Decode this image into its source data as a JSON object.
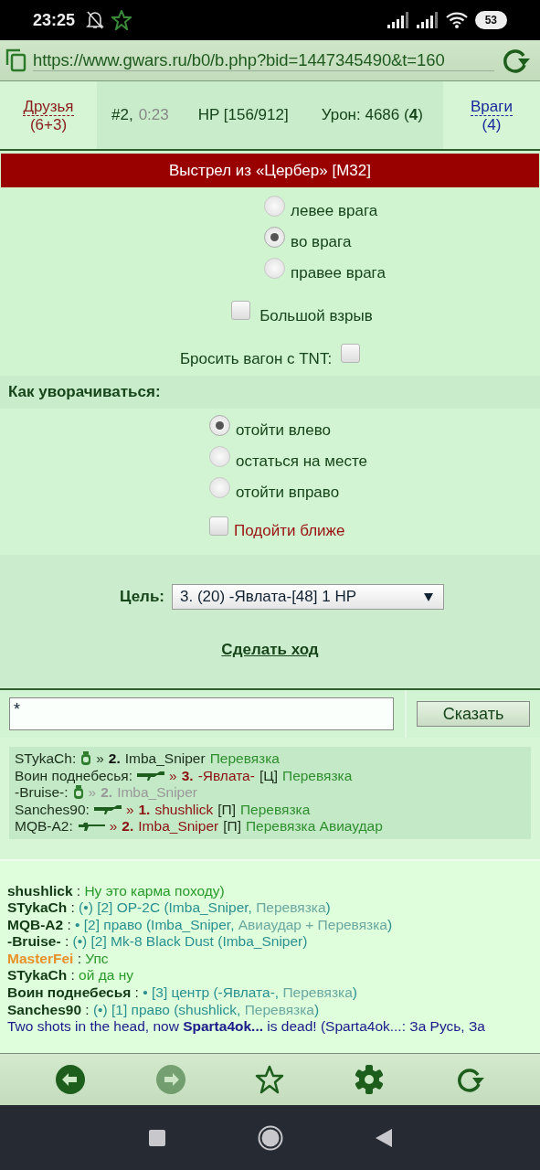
{
  "status_bar": {
    "time": "23:25",
    "battery": "53"
  },
  "address_bar": {
    "url": "https://www.gwars.ru/b0/b.php?bid=1447345490&t=160"
  },
  "header": {
    "friends": {
      "label": "Друзья",
      "count": "(6+3)"
    },
    "turn": "#2,",
    "timer": "0:23",
    "hp": "HP [156/912]",
    "damage": "Урон: 4686 (**4**)",
    "enemies": {
      "label": "Враги",
      "count": "(4)"
    }
  },
  "shot": {
    "title": "Выстрел из «Цербер» [M32]",
    "aim": [
      {
        "label": "левее врага",
        "selected": false
      },
      {
        "label": "во врага",
        "selected": true
      },
      {
        "label": "правее врага",
        "selected": false
      }
    ],
    "big_blast": {
      "label": "Большой взрыв",
      "checked": false
    },
    "tnt": {
      "label": "Бросить вагон с TNT:",
      "checked": false
    }
  },
  "dodge": {
    "title": "Как уворачиваться:",
    "options": [
      {
        "label": "отойти влево",
        "selected": true
      },
      {
        "label": "остаться на месте",
        "selected": false
      },
      {
        "label": "отойти вправо",
        "selected": false
      }
    ],
    "approach": {
      "label": "Подойти ближе",
      "checked": false
    }
  },
  "target": {
    "label": "Цель:",
    "value": "3. (20) -Явлата-[48] 1 HP"
  },
  "submit": "Сделать ход",
  "chat_input": {
    "value": "*",
    "button": "Сказать"
  },
  "log": [
    [
      {
        "kind": "plain",
        "text": "STykaCh:"
      },
      {
        "kind": "grenade"
      },
      {
        "kind": "plain",
        "text": "»"
      },
      {
        "kind": "bold",
        "text": "2."
      },
      {
        "kind": "plain",
        "text": "Imba_Sniper"
      },
      {
        "kind": "heal",
        "text": "Перевязка"
      }
    ],
    [
      {
        "kind": "plain",
        "text": "Воин поднебесья:"
      },
      {
        "kind": "rifle"
      },
      {
        "kind": "enemy",
        "text": "»"
      },
      {
        "kind": "enemy-bold",
        "text": "3."
      },
      {
        "kind": "enemy",
        "text": "-Явлата-"
      },
      {
        "kind": "plain",
        "text": "[Ц]"
      },
      {
        "kind": "heal",
        "text": "Перевязка"
      }
    ],
    [
      {
        "kind": "plain",
        "text": "-Bruise-:"
      },
      {
        "kind": "grenade"
      },
      {
        "kind": "grey",
        "text": "»"
      },
      {
        "kind": "grey-bold",
        "text": "2."
      },
      {
        "kind": "grey",
        "text": "Imba_Sniper"
      }
    ],
    [
      {
        "kind": "plain",
        "text": "Sanches90:"
      },
      {
        "kind": "rifle"
      },
      {
        "kind": "enemy",
        "text": "»"
      },
      {
        "kind": "enemy-bold",
        "text": "1."
      },
      {
        "kind": "enemy",
        "text": "shushlick"
      },
      {
        "kind": "plain",
        "text": "[П]"
      },
      {
        "kind": "heal",
        "text": "Перевязка"
      }
    ],
    [
      {
        "kind": "plain",
        "text": "MQB-A2:"
      },
      {
        "kind": "gun"
      },
      {
        "kind": "enemy",
        "text": "»"
      },
      {
        "kind": "enemy-bold",
        "text": "2."
      },
      {
        "kind": "enemy",
        "text": "Imba_Sniper"
      },
      {
        "kind": "plain",
        "text": "[П]"
      },
      {
        "kind": "heal",
        "text": "Перевязка Авиаудар"
      }
    ]
  ],
  "chat": [
    {
      "kind": "player",
      "name": "shushlick",
      "parts": [
        {
          "kind": "plain",
          "text": " : "
        },
        {
          "kind": "say",
          "text": "Ну это карма походу)"
        }
      ]
    },
    {
      "kind": "player",
      "name": "STykaCh",
      "parts": [
        {
          "kind": "plain",
          "text": " : "
        },
        {
          "kind": "action",
          "text": "(•) [2] ОР-2С (Imba_Sniper,"
        },
        {
          "kind": "note",
          "text": " Перевязка"
        },
        {
          "kind": "action",
          "text": ")"
        }
      ]
    },
    {
      "kind": "player",
      "name": "MQB-A2",
      "parts": [
        {
          "kind": "plain",
          "text": " : "
        },
        {
          "kind": "action",
          "text": "• [2] право (Imba_Sniper,"
        },
        {
          "kind": "note",
          "text": " Авиаудар + Перевязка"
        },
        {
          "kind": "action",
          "text": ")"
        }
      ]
    },
    {
      "kind": "player",
      "name": "-Bruise-",
      "parts": [
        {
          "kind": "plain",
          "text": " : "
        },
        {
          "kind": "action",
          "text": "(•) [2] Mk-8 Black Dust (Imba_Sniper)"
        }
      ]
    },
    {
      "kind": "admin",
      "name": "MasterFei",
      "parts": [
        {
          "kind": "plain",
          "text": " : "
        },
        {
          "kind": "say",
          "text": "Упс"
        }
      ]
    },
    {
      "kind": "player",
      "name": "STykaCh",
      "parts": [
        {
          "kind": "plain",
          "text": " : "
        },
        {
          "kind": "say",
          "text": "ой да ну"
        }
      ]
    },
    {
      "kind": "player",
      "name": "Воин поднебесья",
      "parts": [
        {
          "kind": "plain",
          "text": " : "
        },
        {
          "kind": "action",
          "text": "• [3] центр (-Явлата-,"
        },
        {
          "kind": "note",
          "text": " Перевязка"
        },
        {
          "kind": "action",
          "text": ")"
        }
      ]
    },
    {
      "kind": "player",
      "name": "Sanches90",
      "parts": [
        {
          "kind": "plain",
          "text": " : "
        },
        {
          "kind": "action",
          "text": "(•) [1] право (shushlick,"
        },
        {
          "kind": "note",
          "text": " Перевязка"
        },
        {
          "kind": "action",
          "text": ")"
        }
      ]
    },
    {
      "kind": "system",
      "text": "Two shots in the head, now **Sparta4ok...** is dead! (Sparta4ok...: За Русь, За"
    }
  ],
  "toolbar": [
    {
      "kind": "back",
      "disabled": false
    },
    {
      "kind": "forward",
      "disabled": true
    },
    {
      "kind": "bookmark",
      "disabled": false
    },
    {
      "kind": "settings",
      "disabled": false
    },
    {
      "kind": "reload",
      "disabled": false
    }
  ]
}
